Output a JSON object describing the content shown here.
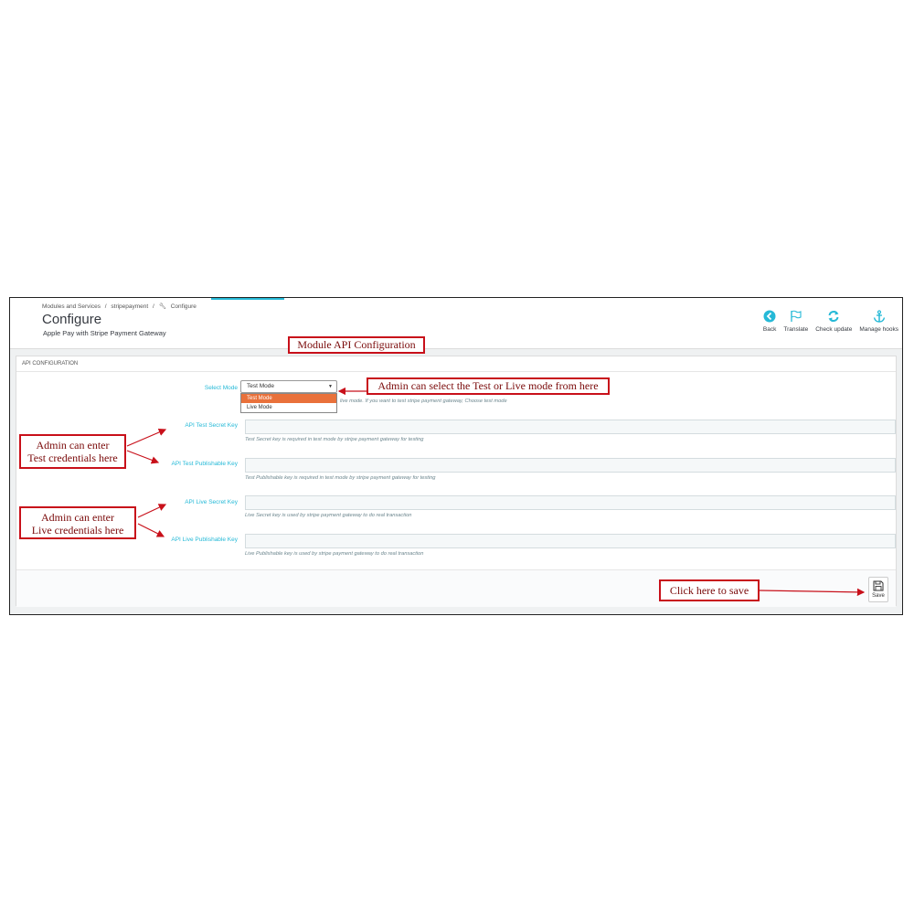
{
  "breadcrumb": {
    "items": [
      "Modules and Services",
      "/",
      "stripepayment",
      "/",
      "Configure"
    ]
  },
  "header": {
    "title": "Configure",
    "subtitle": "Apple Pay with Stripe Payment Gateway"
  },
  "toolbar": {
    "back": "Back",
    "translate": "Translate",
    "check_update": "Check update",
    "manage_hooks": "Manage hooks"
  },
  "panel": {
    "heading": "API CONFIGURATION",
    "select_mode": {
      "label": "Select Mode",
      "value": "Test Mode",
      "options": [
        "Test Mode",
        "Live Mode"
      ],
      "help": "live mode. If you want to test stripe payment gateway, Choose test mode"
    },
    "test_secret": {
      "label": "API Test Secret Key",
      "help": "Test Secret key is required in test mode by stripe payment gateway for testing"
    },
    "test_publishable": {
      "label": "API Test Publishable Key",
      "help": "Test Publishable key is required in test mode by stripe payment gateway for testing"
    },
    "live_secret": {
      "label": "API Live Secret Key",
      "help": "Live Secret key is used by stripe payment gateway to do real transaction"
    },
    "live_publishable": {
      "label": "API Live Publishable Key",
      "help": "Live Publishable key is used by stripe payment gateway to do real transaction"
    },
    "save": "Save"
  },
  "callouts": {
    "module_api": "Module API Configuration",
    "select_mode": "Admin can select the Test or Live mode from here",
    "test_line1": "Admin can enter",
    "test_line2": "Test credentials here",
    "live_line1": "Admin can enter",
    "live_line2": "Live credentials here",
    "save": "Click here to save"
  },
  "colors": {
    "accent": "#25b9d7",
    "callout_border": "#c8101a",
    "selected_option": "#e9713b"
  }
}
